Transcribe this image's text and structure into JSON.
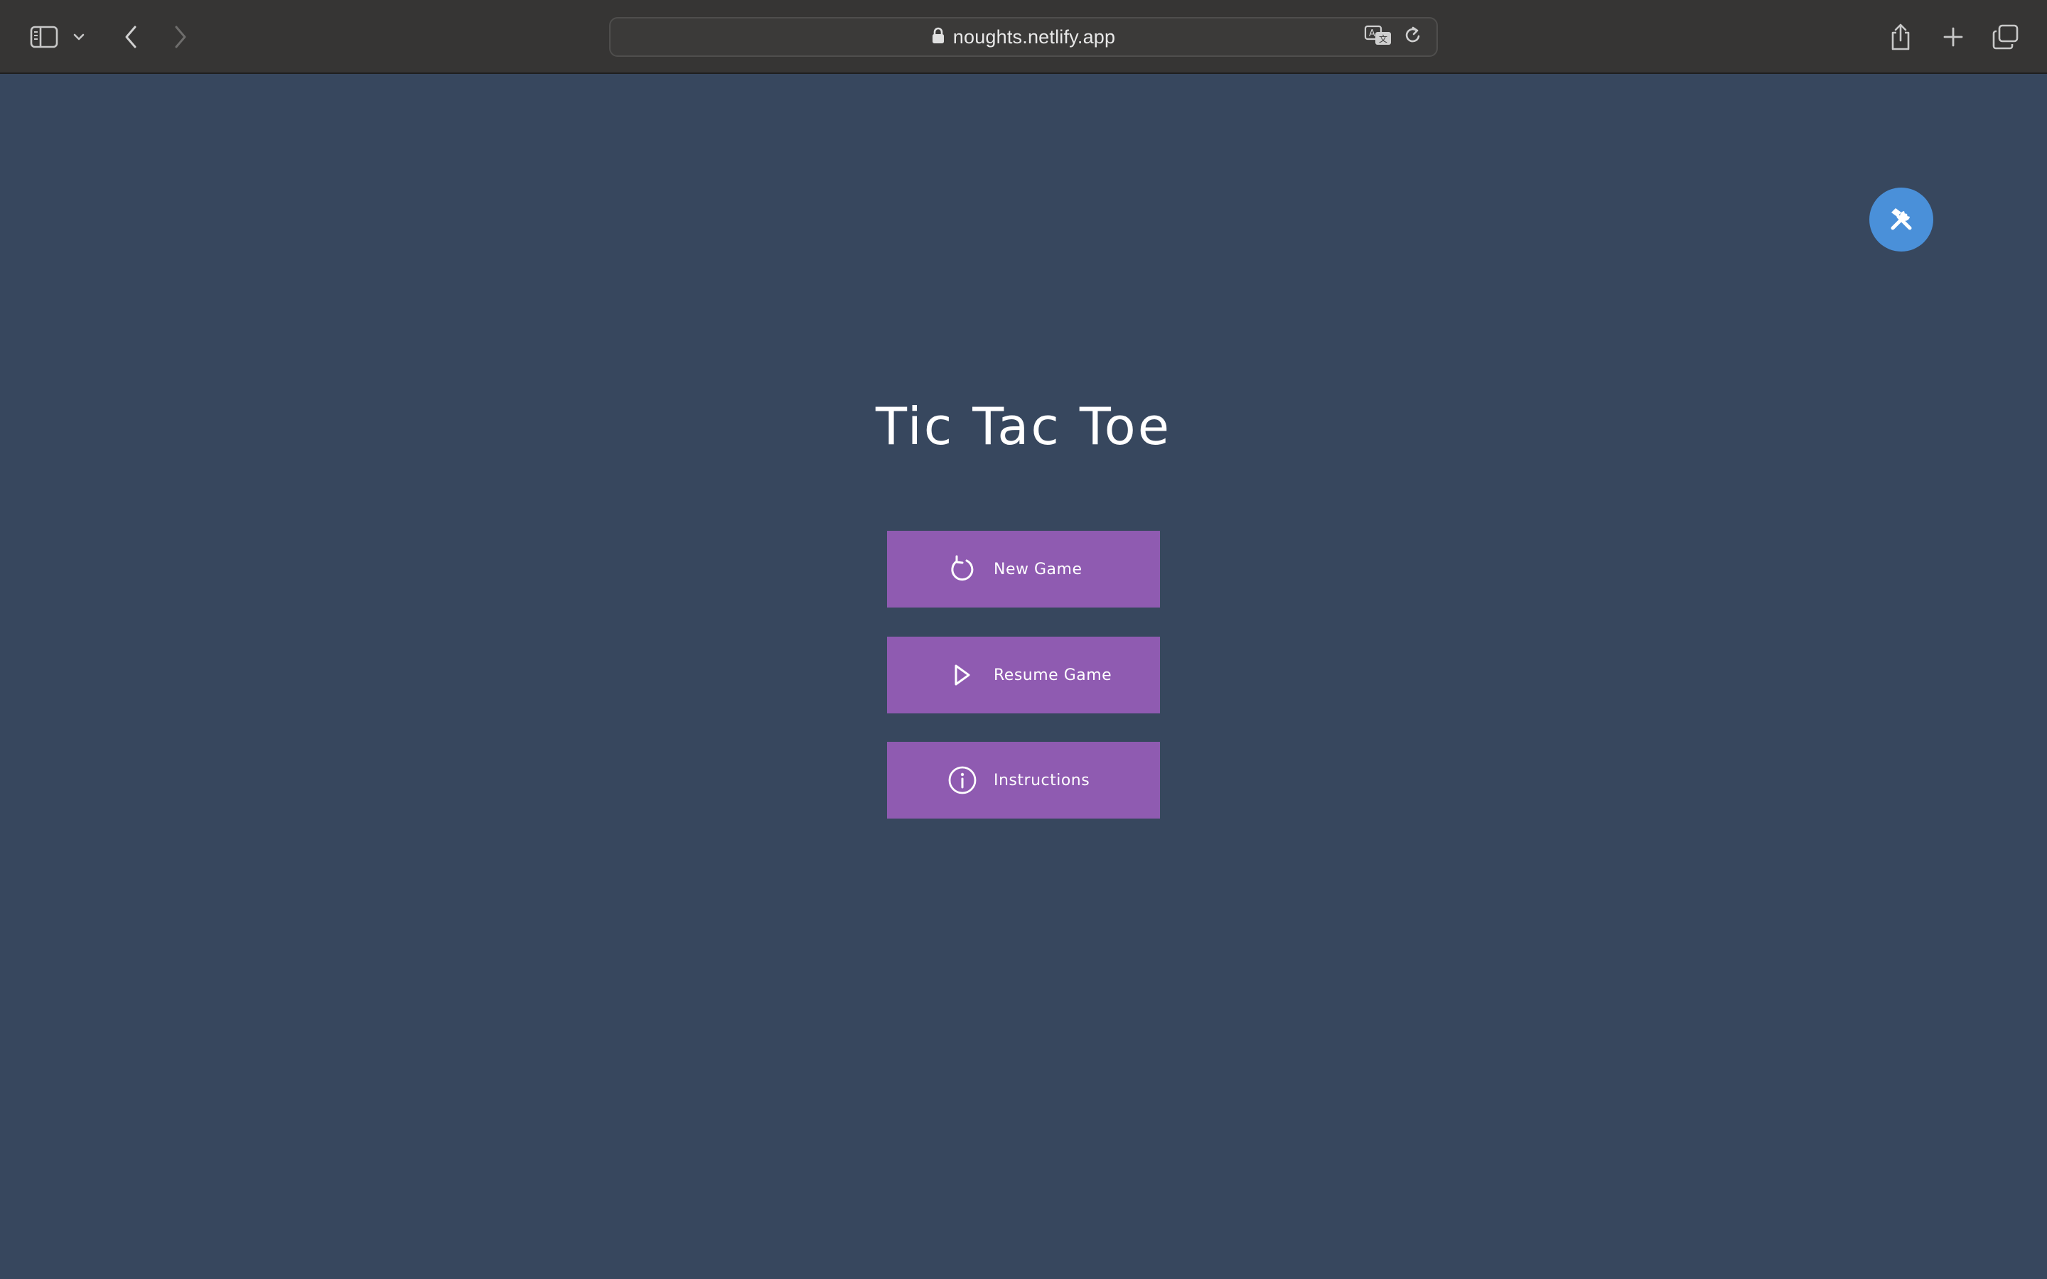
{
  "browser": {
    "url": "noughts.netlify.app",
    "icons": {
      "sidebar": "sidebar-icon",
      "sidebar_menu": "chevron-down-icon",
      "back": "chevron-left-icon",
      "forward": "chevron-right-icon",
      "lock": "lock-icon",
      "translate": "translate-icon",
      "reload": "reload-icon",
      "share": "share-icon",
      "new_tab": "plus-icon",
      "tabs": "tabs-overview-icon"
    }
  },
  "page": {
    "title": "Tic Tac Toe",
    "background_color": "#37475e",
    "button_color": "#8f5bb1",
    "fab_color": "#4a90d9",
    "fab_icon": "tools-icon",
    "buttons": [
      {
        "label": "New Game",
        "icon": "restart-icon"
      },
      {
        "label": "Resume Game",
        "icon": "play-icon"
      },
      {
        "label": "Instructions",
        "icon": "info-icon"
      }
    ]
  }
}
